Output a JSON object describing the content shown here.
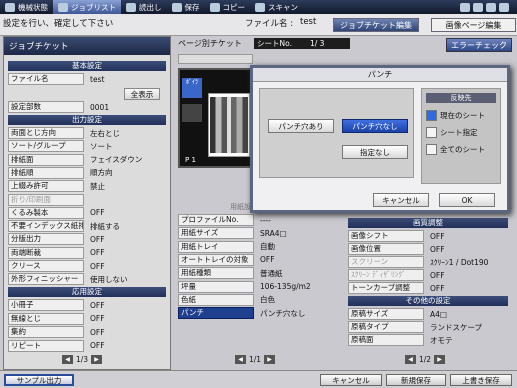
{
  "topbar": {
    "items": [
      "機械状態",
      "ジョブリスト",
      "読出し",
      "保存",
      "コピー",
      "スキャン"
    ]
  },
  "instruction": "設定を行い、確定して下さい",
  "file": {
    "label": "ファイル名 :",
    "value": "test"
  },
  "tabs": [
    "ジョブチケット編集",
    "画像ページ編集"
  ],
  "left": {
    "title": "ジョブチケット",
    "sections": {
      "basic": "基本設定",
      "output": "出力設定",
      "apply": "応用設定"
    },
    "filename_label": "ファイル名",
    "filename_value": "test",
    "show_all": "全表示",
    "copies_label": "設定部数",
    "copies_value": "0001",
    "output_rows": [
      [
        "両面とじ方向",
        "左右とじ"
      ],
      [
        "ソート/グループ",
        "ソート"
      ],
      [
        "排紙面",
        "フェイスダウン"
      ],
      [
        "排紙順",
        "順方向"
      ],
      [
        "上綴み許可",
        "禁止"
      ],
      [
        "折り/印刷面",
        ""
      ],
      [
        "くるみ製本",
        "OFF"
      ],
      [
        "不要インデックス紙排紙",
        "排紙する"
      ],
      [
        "分版出力",
        "OFF"
      ],
      [
        "両端断裁",
        "OFF"
      ],
      [
        "クリース",
        "OFF"
      ],
      [
        "外形フィニッシャー",
        "使用しない"
      ]
    ],
    "apply_rows": [
      [
        "小冊子",
        "OFF"
      ],
      [
        "無線とじ",
        "OFF"
      ],
      [
        "集約",
        "OFF"
      ],
      [
        "リピート",
        "OFF"
      ]
    ],
    "pager": "1/3"
  },
  "middle": {
    "header": "ページ別チケット",
    "sheet_label": "シートNo.",
    "sheet_value": "1/ 3",
    "error_check": "エラーチェック",
    "thumb_a": "ﾎﾞｲﾗ",
    "page_no": "P 1",
    "subtitle": "用紙設定",
    "rows": [
      [
        "プロファイルNo.",
        "----"
      ],
      [
        "用紙サイズ",
        "SRA4□"
      ],
      [
        "用紙トレイ",
        "自動"
      ],
      [
        "オートトレイの対象",
        "OFF"
      ],
      [
        "用紙種類",
        "普通紙"
      ],
      [
        "坪量",
        "106-135g/m2"
      ],
      [
        "色紙",
        "白色"
      ],
      [
        "パンチ",
        "パンチ穴なし"
      ]
    ],
    "pager": "1/1"
  },
  "right": {
    "section1": "画質調整",
    "rows1": [
      [
        "画像シフト",
        "OFF"
      ],
      [
        "画像位置",
        "OFF"
      ],
      [
        "スクリーン",
        "ｽｸﾘｰﾝ1 / Dot190"
      ],
      [
        "ｽｸﾘｰﾝ ﾃﾞｨｻﾞﾘﾝｸﾞ",
        "OFF"
      ],
      [
        "トーンカーブ調整",
        "OFF"
      ]
    ],
    "section2": "その他の設定",
    "rows2": [
      [
        "原稿サイズ",
        "A4□"
      ],
      [
        "原稿タイプ",
        "ランドスケープ"
      ],
      [
        "原稿面",
        "オモテ"
      ]
    ],
    "pager": "1/2"
  },
  "dialog": {
    "title": "パンチ",
    "opt_punch": "パンチ穴あり",
    "opt_nopunch": "パンチ穴なし",
    "opt_none": "指定なし",
    "cancel": "キャンセル",
    "ok": "OK",
    "reflect_title": "反映先",
    "reflect": [
      "現在のシート",
      "シート指定",
      "全てのシート"
    ]
  },
  "bottom": {
    "sample": "サンプル出力",
    "cancel": "キャンセル",
    "save_new": "新規保存",
    "overwrite": "上書き保存"
  }
}
